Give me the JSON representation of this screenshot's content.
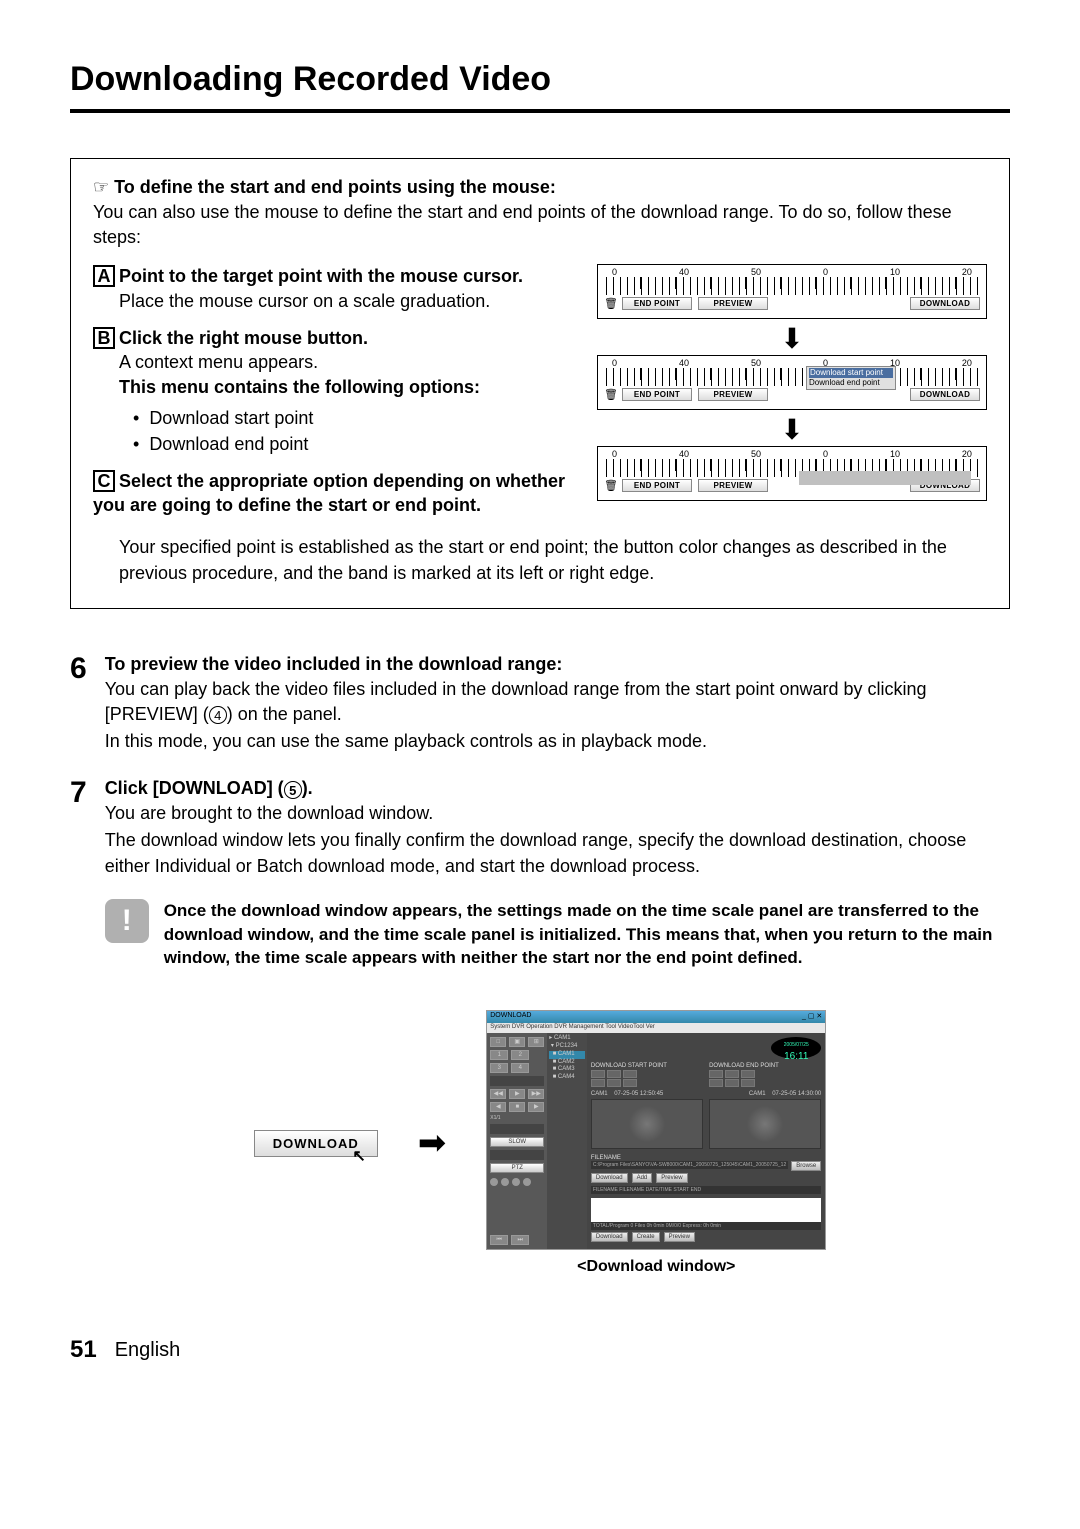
{
  "page": {
    "title": "Downloading Recorded Video",
    "number": "51",
    "language": "English"
  },
  "box": {
    "heading": "To define the start and end points using the mouse:",
    "intro": "You can also use the mouse to define the start and end points of the download range. To do so, follow these steps:",
    "stepA": {
      "letter": "A",
      "head": "Point to the target point with the mouse cursor.",
      "body": "Place the mouse cursor on a scale graduation."
    },
    "stepB": {
      "letter": "B",
      "head": "Click the right mouse button.",
      "body": "A context menu appears.",
      "subhead": "This menu contains the following options:",
      "bullets": [
        "Download start point",
        "Download end point"
      ]
    },
    "stepC": {
      "letter": "C",
      "head": "Select the appropriate option depending on whether you are going to define the start or end point.",
      "after": "Your specified point is established as the start or end point; the button color changes as described in the previous procedure, and the band is marked at its left or right edge."
    },
    "scales": {
      "numbers": [
        "0",
        "40",
        "50",
        "0",
        "10",
        "20"
      ],
      "buttons": {
        "end": "END POINT",
        "preview": "PREVIEW",
        "download": "DOWNLOAD"
      },
      "popup": {
        "start": "Download start point",
        "end": "Download end point"
      }
    }
  },
  "step6": {
    "num": "6",
    "head": "To preview the video included in the download range:",
    "p1a": "You can play back the video files included in the download range from the start point onward by clicking [PREVIEW] (",
    "p1_circle": "4",
    "p1b": ") on the panel.",
    "p2": "In this mode, you can use the same playback controls as in playback mode."
  },
  "step7": {
    "num": "7",
    "head_a": "Click [DOWNLOAD] (",
    "head_circle": "5",
    "head_b": ").",
    "p1": "You are brought to the download window.",
    "p2": "The download window lets you finally confirm the download range, specify the download destination, choose either Individual or Batch download mode, and start the download process.",
    "warn": "Once the download window appears, the settings made on the time scale panel are transferred to the download window, and the time scale panel is initialized. This means that, when you return to the main window, the time scale appears with neither the start nor the end point defined."
  },
  "figure": {
    "button": "DOWNLOAD",
    "window": {
      "title": "DOWNLOAD",
      "menu": "System  DVR Operation  DVR Management  Tool  VideoTool  Ver",
      "clock_date": "2005/07/25",
      "clock_time": "16:11",
      "start_label": "DOWNLOAD START POINT",
      "end_label": "DOWNLOAD END POINT",
      "cam": "CAM1",
      "start_dt": "07-25-05 12:50:45",
      "end_dt": "07-25-05 14:30:00",
      "filename_label": "FILENAME",
      "path": "C:\\Program Files\\SANYO\\VA-SW8000\\CAM1_20050725_125045\\CAM1_20050725_12",
      "browse": "Browse",
      "btns": {
        "download": "Download",
        "add": "Add",
        "preview": "Preview",
        "create": "Create"
      },
      "list_cols": "FILENAME    FILENAME    DATE/TIME START    END",
      "total": "TOTAL/Program 0 Files 0h 0min 0M/0/0 Express: 0h 0min",
      "sidebar": {
        "nums": [
          "1",
          "2",
          "3",
          "4"
        ],
        "slow": "SLOW",
        "ptz": "PTZ"
      },
      "tree": [
        "CAM1",
        "PC1234",
        "CAM1",
        "CAM2",
        "CAM3",
        "CAM4"
      ]
    },
    "caption": "<Download window>"
  }
}
